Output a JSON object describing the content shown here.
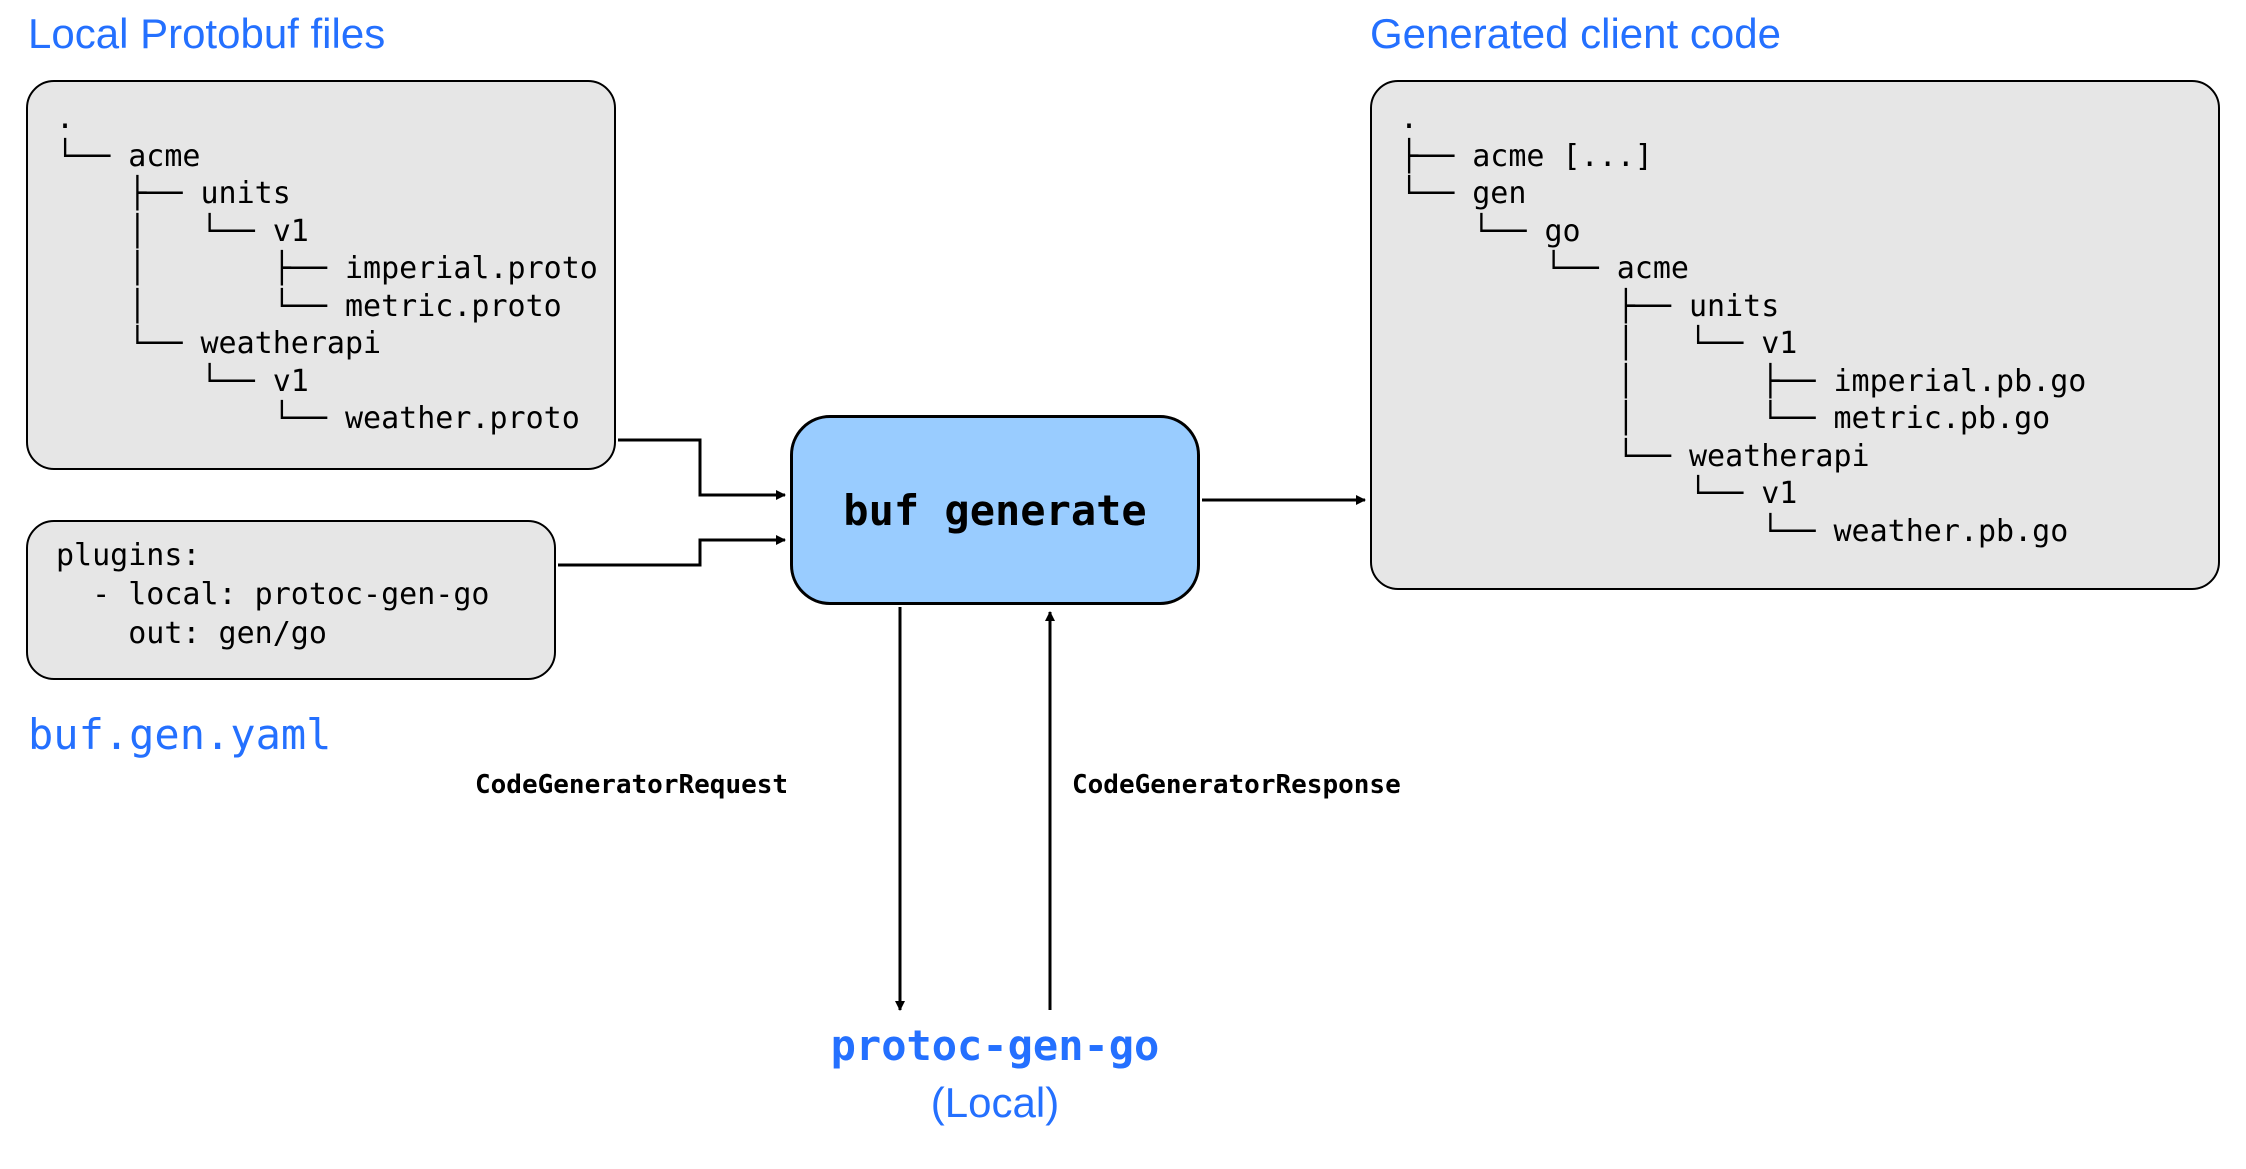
{
  "headings": {
    "local_proto": "Local Protobuf files",
    "generated_code": "Generated client code",
    "buf_gen_yaml": "buf.gen.yaml"
  },
  "center": {
    "label": "buf generate"
  },
  "edges": {
    "request": "CodeGeneratorRequest",
    "response": "CodeGeneratorResponse"
  },
  "plugin": {
    "name": "protoc-gen-go",
    "where": "(Local)"
  },
  "left_tree": ".\n└── acme\n    ├── units\n    │   └── v1\n    │       ├── imperial.proto\n    │       └── metric.proto\n    └── weatherapi\n        └── v1\n            └── weather.proto",
  "yaml_box": "plugins:\n  - local: protoc-gen-go\n    out: gen/go",
  "right_tree": ".\n├── acme [...]\n└── gen\n    └── go\n        └── acme\n            ├── units\n            │   └── v1\n            │       ├── imperial.pb.go\n            │       └── metric.pb.go\n            └── weatherapi\n                └── v1\n                    └── weather.pb.go"
}
